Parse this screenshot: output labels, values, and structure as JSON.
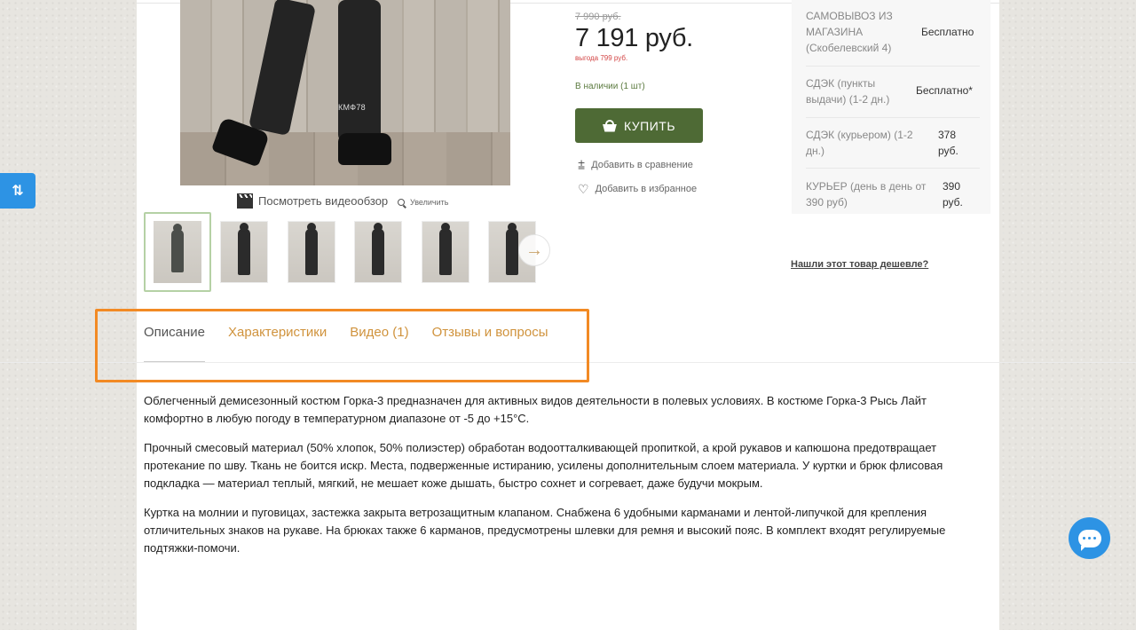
{
  "product": {
    "image_watermark": "КМФ78",
    "video_link": "Посмотреть видеообзор",
    "zoom_link": "Увеличить"
  },
  "pricing": {
    "old_price": "7 990 руб.",
    "price": "7 191 руб.",
    "saving": "выгода 799 руб.",
    "stock": "В наличии (1 шт)",
    "buy_label": "КУПИТЬ",
    "compare_label": "Добавить в сравнение",
    "favorite_label": "Добавить в избранное"
  },
  "delivery": [
    {
      "label": "САМОВЫВОЗ ИЗ МАГАЗИНА (Скобелевский 4)",
      "value": "Бесплатно"
    },
    {
      "label": "СДЭК (пункты выдачи) (1-2 дн.)",
      "value": "Бесплатно*"
    },
    {
      "label": "СДЭК (курьером) (1-2 дн.)",
      "value": "378 руб."
    },
    {
      "label": "КУРЬЕР (день в день от 390 руб)",
      "value": "390 руб."
    }
  ],
  "cheaper_link": "Нашли этот товар дешевле?",
  "tabs": [
    {
      "label": "Описание"
    },
    {
      "label": "Характеристики"
    },
    {
      "label": "Видео (1)"
    },
    {
      "label": "Отзывы и вопросы"
    }
  ],
  "description": [
    "Облегченный демисезонный костюм Горка-3 предназначен для активных видов деятельности в полевых условиях. В костюме Горка-3 Рысь Лайт комфортно в любую погоду в температурном диапазоне от -5 до +15°C.",
    "Прочный смесовый материал (50% хлопок, 50% полиэстер) обработан водоотталкивающей пропиткой, а крой рукавов и капюшона предотвращает протекание по шву. Ткань не боится искр. Места, подверженные истиранию, усилены дополнительным слоем материала. У куртки и брюк флисовая подкладка — материал теплый, мягкий, не мешает коже дышать, быстро сохнет и согревает, даже будучи мокрым.",
    "Куртка на молнии и пуговицах, застежка закрыта ветрозащитным клапаном. Снабжена 6 удобными карманами и лентой-липучкой для крепления отличительных знаков на рукаве. На брюках также 6 карманов, предусмотрены шлевки для ремня и высокий пояс. В комплект входят регулируемые подтяжки-помочи."
  ],
  "colors": {
    "accent_green": "#4e6a35",
    "tab_orange": "#d0933d",
    "highlight": "#f28a24",
    "widget_blue": "#2d93e4"
  }
}
